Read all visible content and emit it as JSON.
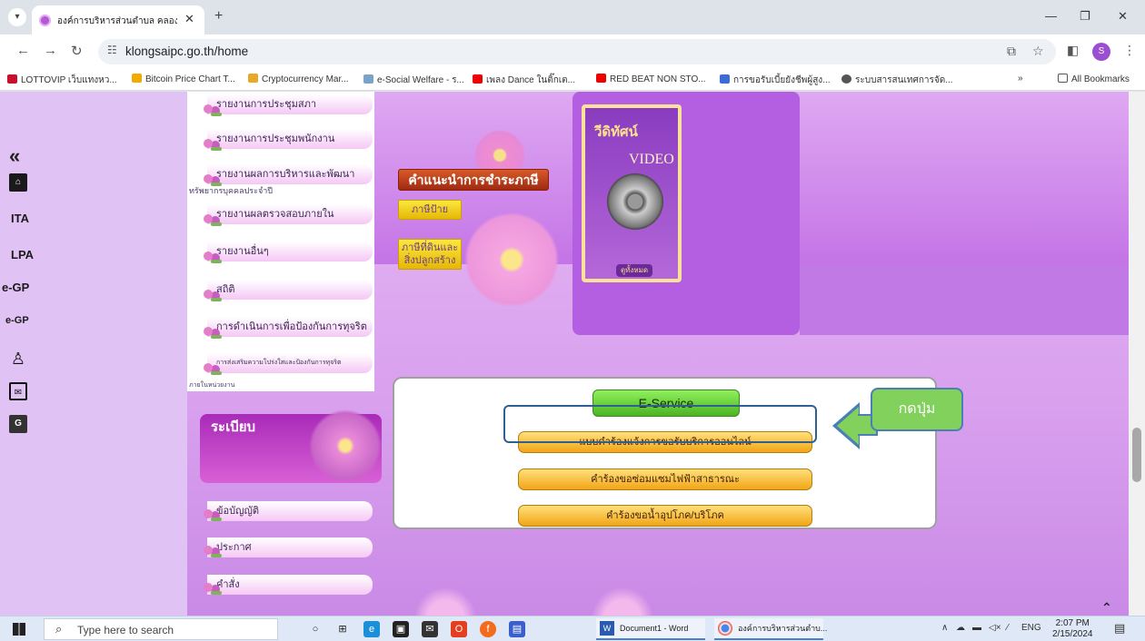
{
  "browser": {
    "tab_title": "องค์การบริหารส่วนตำบล คลองทราย",
    "url": "klongsaipc.go.th/home",
    "bookmarks": [
      "LOTTOVIP เว็บแทงหว...",
      "Bitcoin Price Chart T...",
      "Cryptocurrency Mar...",
      "e-Social Welfare - ร...",
      "เพลง Dance ในติ๊กเต...",
      "RED BEAT NON STO...",
      "การขอรับเบี้ยยังชีพผู้สูง...",
      "ระบบสารสนเทศการจัด..."
    ],
    "all_bookmarks": "All Bookmarks",
    "profile_initial": "S"
  },
  "sidebar": {
    "items": [
      "ITA",
      "LPA",
      "e-GP",
      "e-GP"
    ]
  },
  "menu": {
    "items": [
      "รายงานการประชุมสภา",
      "รายงานการประชุมพนักงาน",
      "รายงานผลการบริหารและพัฒนา",
      "รายงานผลตรวจสอบภายใน",
      "รายงานอื่นๆ",
      "สถิติ",
      "การดำเนินการเพื่อป้องกันการทุจริต",
      "การส่งเสริมความโปร่งใสและป้องกันการทุจริต"
    ],
    "sub_hr": "ทรัพยากรบุคคลประจำปี",
    "sub_work": "ภายในหน่วยงาน"
  },
  "tax": {
    "title": "คำแนะนำการชำระภาษี",
    "sign_tax": "ภาษีป้าย",
    "land_tax_line1": "ภาษีที่ดินและ",
    "land_tax_line2": "สิ่งปลูกสร้าง"
  },
  "video": {
    "title_th": "วีดิทัศน์",
    "title_en": "VIDEO",
    "view_all": "ดูทั้งหมด"
  },
  "regulation": {
    "title": "ระเบียบ",
    "items": [
      "ข้อบัญญัติ",
      "ประกาศ",
      "คำสั่ง"
    ]
  },
  "eservice": {
    "title": "E-Service",
    "buttons": [
      "แบบคำร้องแจ้งการขอรับบริการออนไลน์",
      "คำร้องขอซ่อมแซมไฟฟ้าสาธารณะ",
      "คำร้องขอน้ำอุปโภค/บริโภค"
    ]
  },
  "annotation": {
    "callout": "กดปุ่ม"
  },
  "taskbar": {
    "search_placeholder": "Type here to search",
    "word_window": "Document1 - Word",
    "chrome_window": "องค์การบริหารส่วนตำบ...",
    "lang": "ENG",
    "time": "2:07 PM",
    "date": "2/15/2024"
  }
}
